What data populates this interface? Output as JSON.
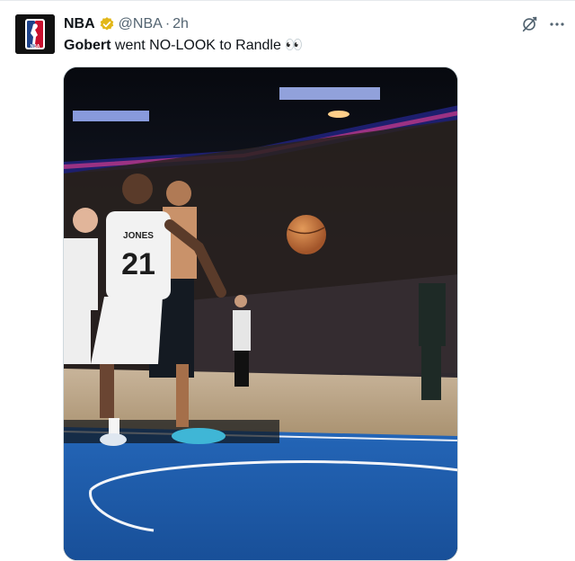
{
  "tweet": {
    "author_name": "NBA",
    "handle": "@NBA",
    "separator": "·",
    "time": "2h",
    "text_bold": "Gobert",
    "text_rest": " went NO-LOOK to Randle 👀",
    "media_jersey_number": "21",
    "media_jersey_name": "JONES",
    "icons": [
      "nba-logo",
      "verified-badge",
      "grok-icon",
      "more-icon"
    ],
    "colors": {
      "verified_gold": "#E2B719",
      "court_blue": "#1d5aa8",
      "muted_text": "#536471"
    }
  }
}
